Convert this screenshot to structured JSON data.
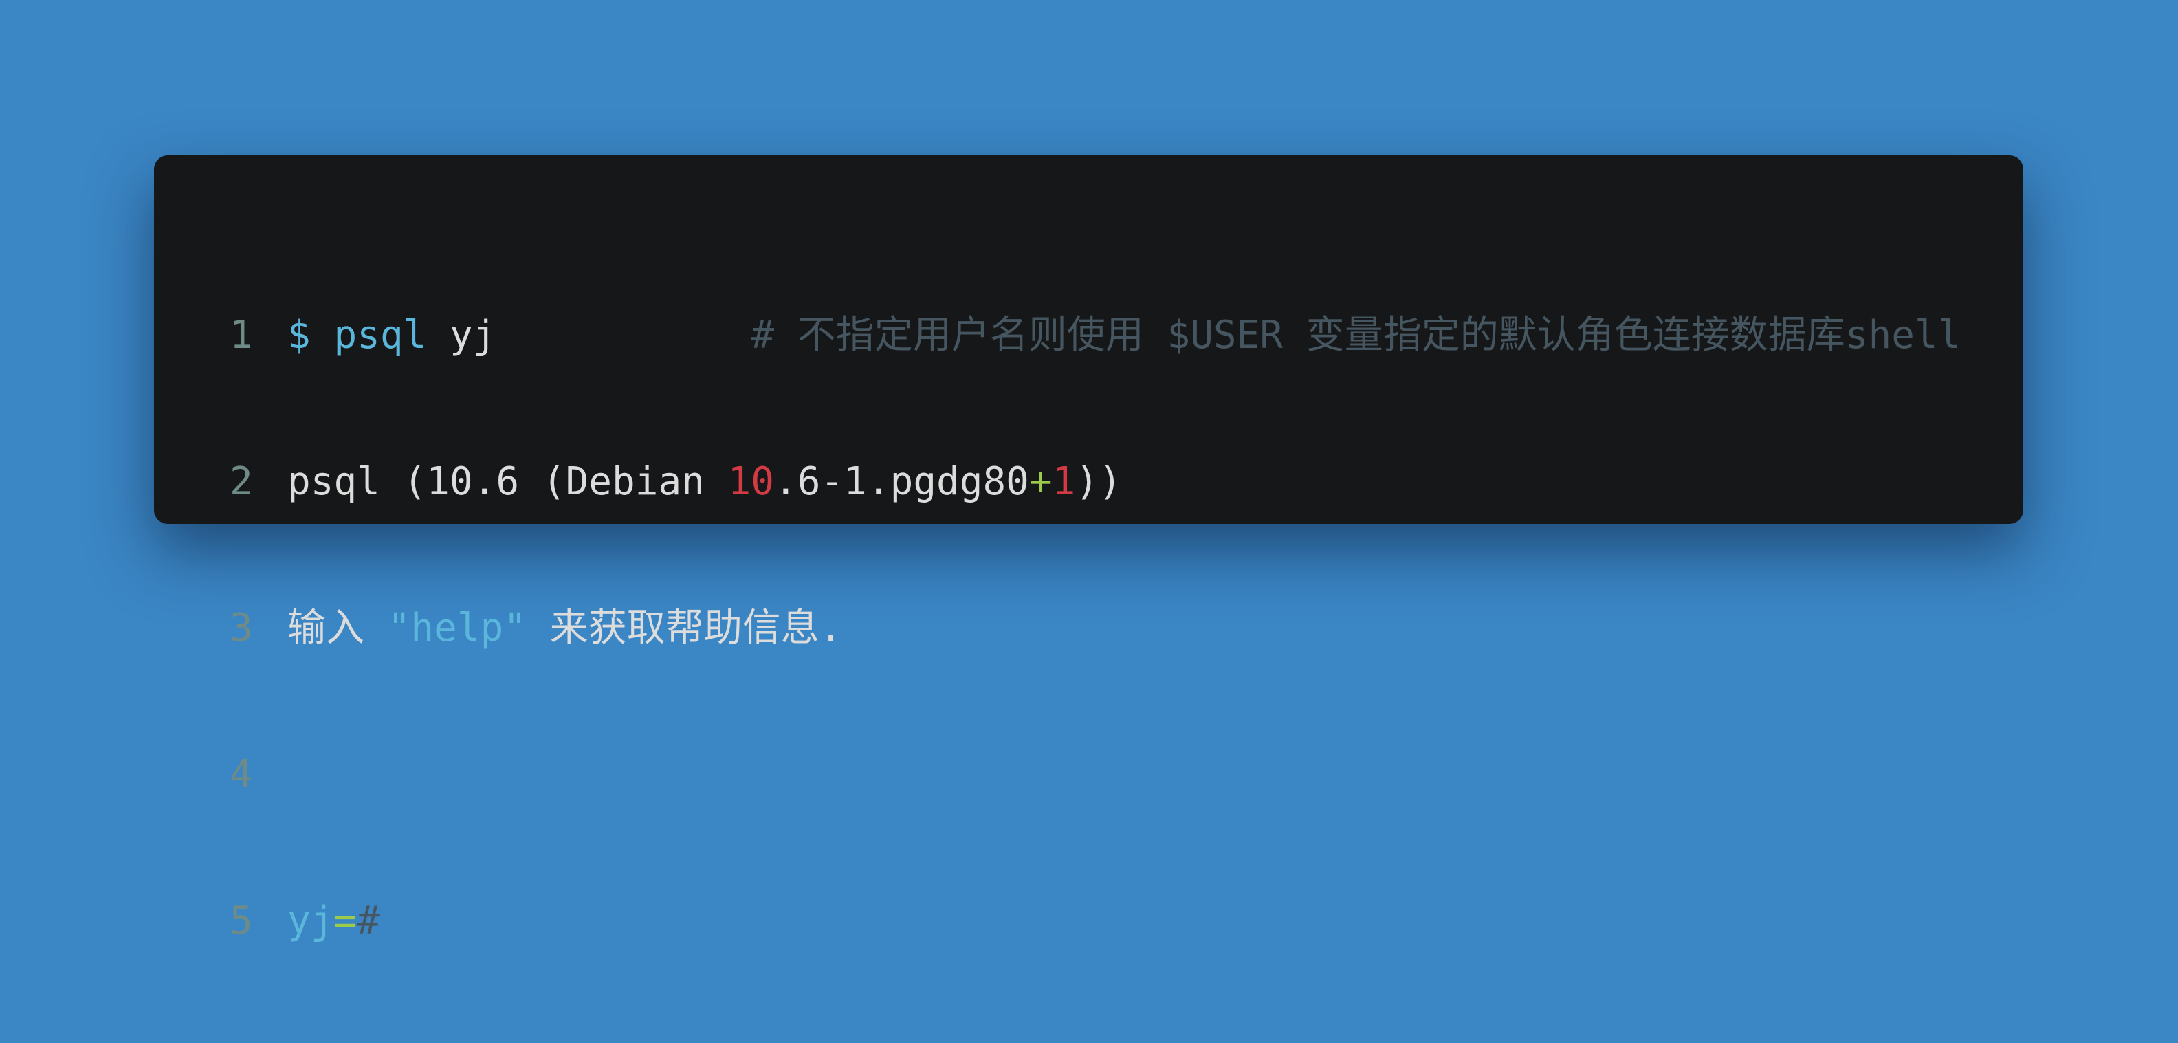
{
  "lines": [
    {
      "num": "1",
      "prompt": "$ ",
      "cmd": "psql",
      "arg": " yj",
      "pad": "           ",
      "comment": "# 不指定用户名则使用 $USER 变量指定的默认角色连接数据库shell"
    },
    {
      "num": "2",
      "t1": "psql (10.6 (Debian ",
      "t2": "10",
      "t3": ".6-1.pgdg80",
      "t4": "+",
      "t5": "1",
      "t6": "))"
    },
    {
      "num": "3",
      "t1": "输入 ",
      "t2": "\"help\"",
      "t3": " 来获取帮助信息."
    },
    {
      "num": "4"
    },
    {
      "num": "5",
      "t1": "yj",
      "t2": "=",
      "t3": "#"
    }
  ],
  "colors": {
    "background": "#3b86c5",
    "card": "#161719",
    "keyword": "#5ab6da",
    "number": "#d23b43",
    "operator": "#9ccb4a",
    "comment": "#465660"
  }
}
